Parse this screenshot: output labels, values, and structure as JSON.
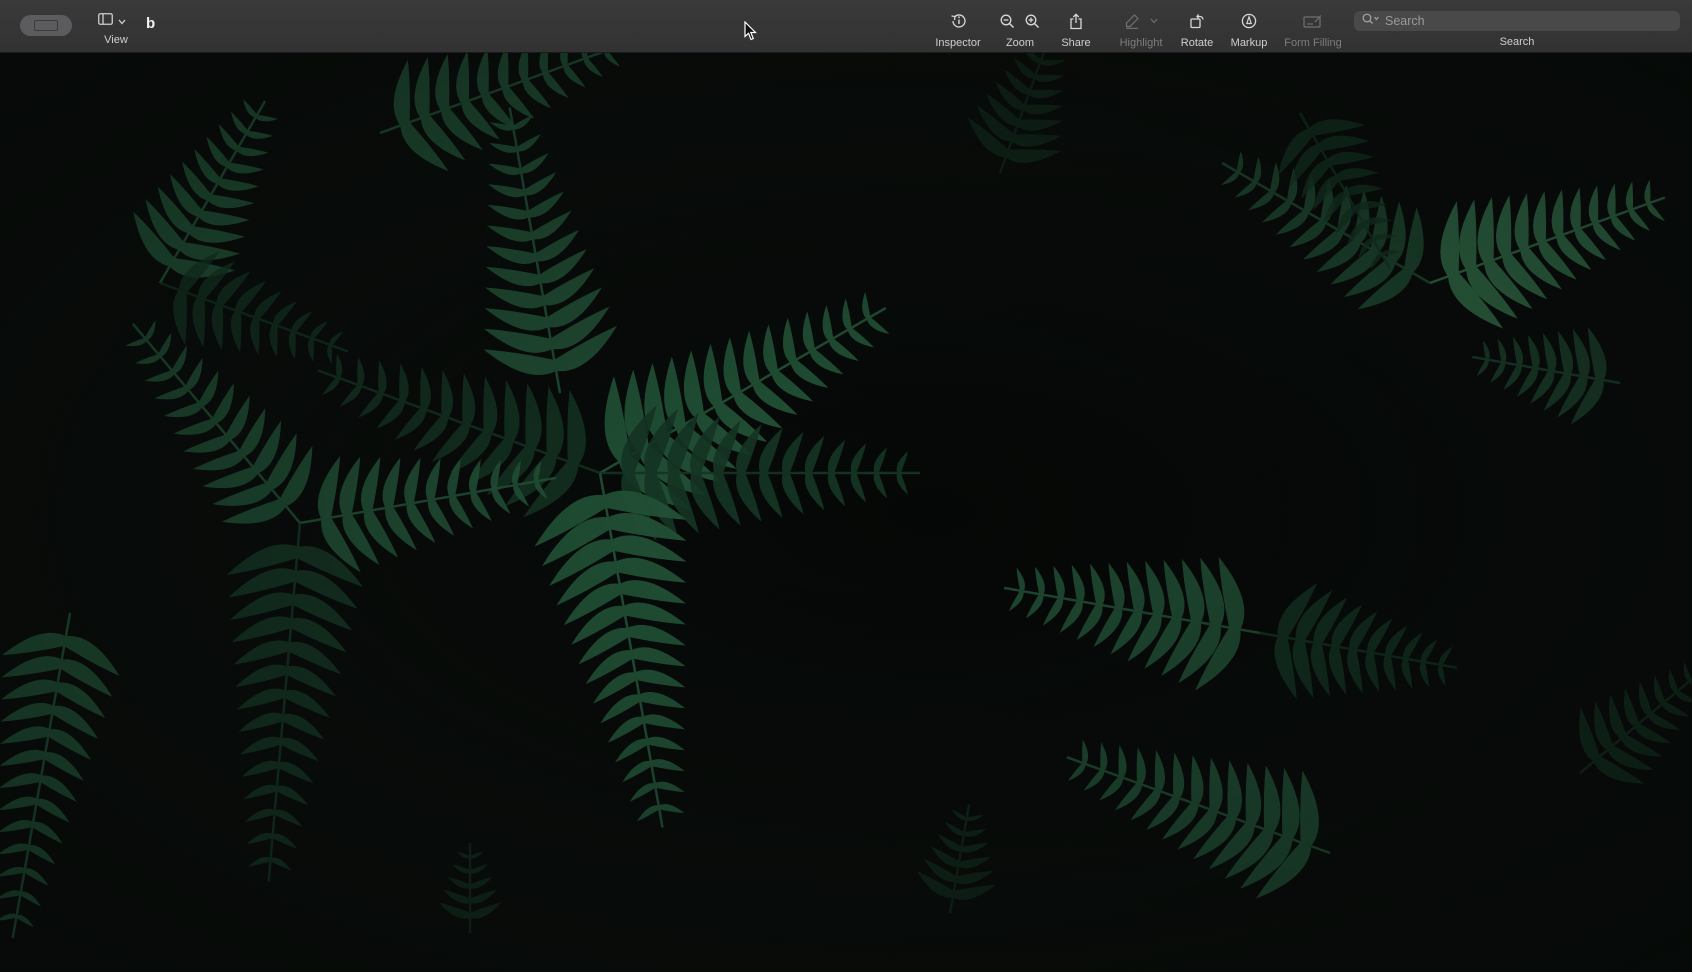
{
  "toolbar": {
    "view_label": "View",
    "document_title": "b",
    "tools": [
      {
        "name": "inspector",
        "label": "Inspector",
        "icon": "info-clock-icon",
        "enabled": true
      },
      {
        "name": "zoom",
        "label": "Zoom",
        "icon": "zoom-out-in-icon",
        "enabled": true
      },
      {
        "name": "share",
        "label": "Share",
        "icon": "share-icon",
        "enabled": true
      },
      {
        "name": "highlight",
        "label": "Highlight",
        "icon": "highlighter-pen-icon",
        "enabled": false
      },
      {
        "name": "rotate",
        "label": "Rotate",
        "icon": "rotate-icon",
        "enabled": true
      },
      {
        "name": "markup",
        "label": "Markup",
        "icon": "markup-pen-icon",
        "enabled": true
      },
      {
        "name": "form_filling",
        "label": "Form Filling",
        "icon": "form-filling-icon",
        "enabled": false
      }
    ],
    "search": {
      "placeholder": "Search",
      "label": "Search",
      "value": ""
    }
  },
  "content": {
    "image_description_icon": "fern-photo",
    "colors": {
      "background": "#050706",
      "leaf_dark": "#163826",
      "leaf_mid": "#24563a",
      "leaf_light": "#3f8a5c"
    }
  }
}
